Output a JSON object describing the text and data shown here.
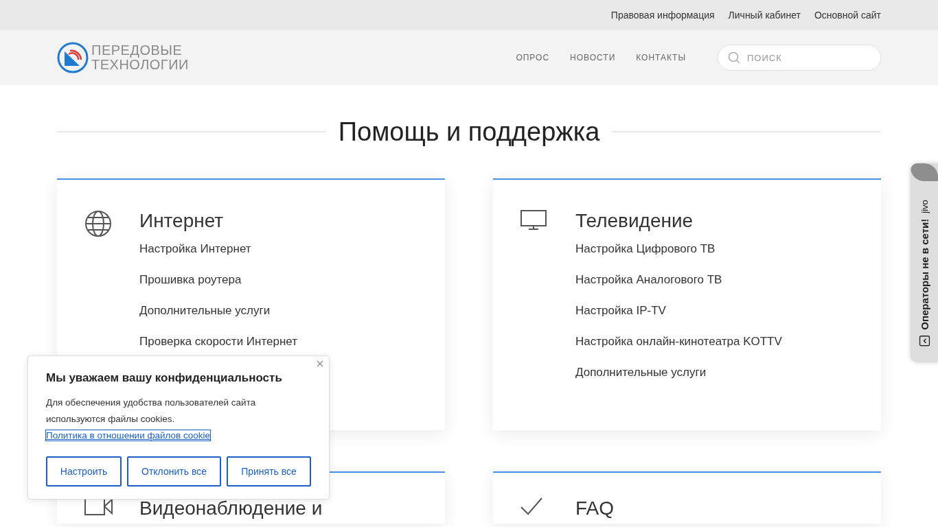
{
  "top_links": [
    "Правовая информация",
    "Личный кабинет",
    "Основной сайт"
  ],
  "logo": {
    "line1": "ПЕРЕДОВЫЕ",
    "line2": "ТЕХНОЛОГИИ"
  },
  "nav": [
    "ОПРОС",
    "НОВОСТИ",
    "КОНТАКТЫ"
  ],
  "search": {
    "placeholder": "ПОИСК"
  },
  "page_title": "Помощь и поддержка",
  "cards": [
    {
      "kind": "globe",
      "title": "Интернет",
      "links": [
        "Настройка Интернет",
        "Прошивка роутера",
        "Дополнительные услуги",
        "Проверка скорости Интернет"
      ]
    },
    {
      "kind": "tv",
      "title": "Телевидение",
      "links": [
        "Настройка Цифрового ТВ",
        "Настройка Аналогового ТВ",
        "Настройка IP-TV",
        "Настройка онлайн-кинотеатра KOTTV",
        "Дополнительные услуги"
      ]
    },
    {
      "kind": "camera",
      "title": "Видеонаблюдение и"
    },
    {
      "kind": "check",
      "title": "FAQ"
    }
  ],
  "cookie": {
    "title": "Мы уважаем вашу конфиденциальность",
    "text": "Для обеспечения удобства пользователей сайта используются файлы cookies.",
    "link": "Политика в отношении файлов cookie",
    "buttons": [
      "Настроить",
      "Отклонить все",
      "Принять все"
    ]
  },
  "chat_tab": {
    "status": "Операторы не в сети!",
    "brand": "jivo"
  }
}
